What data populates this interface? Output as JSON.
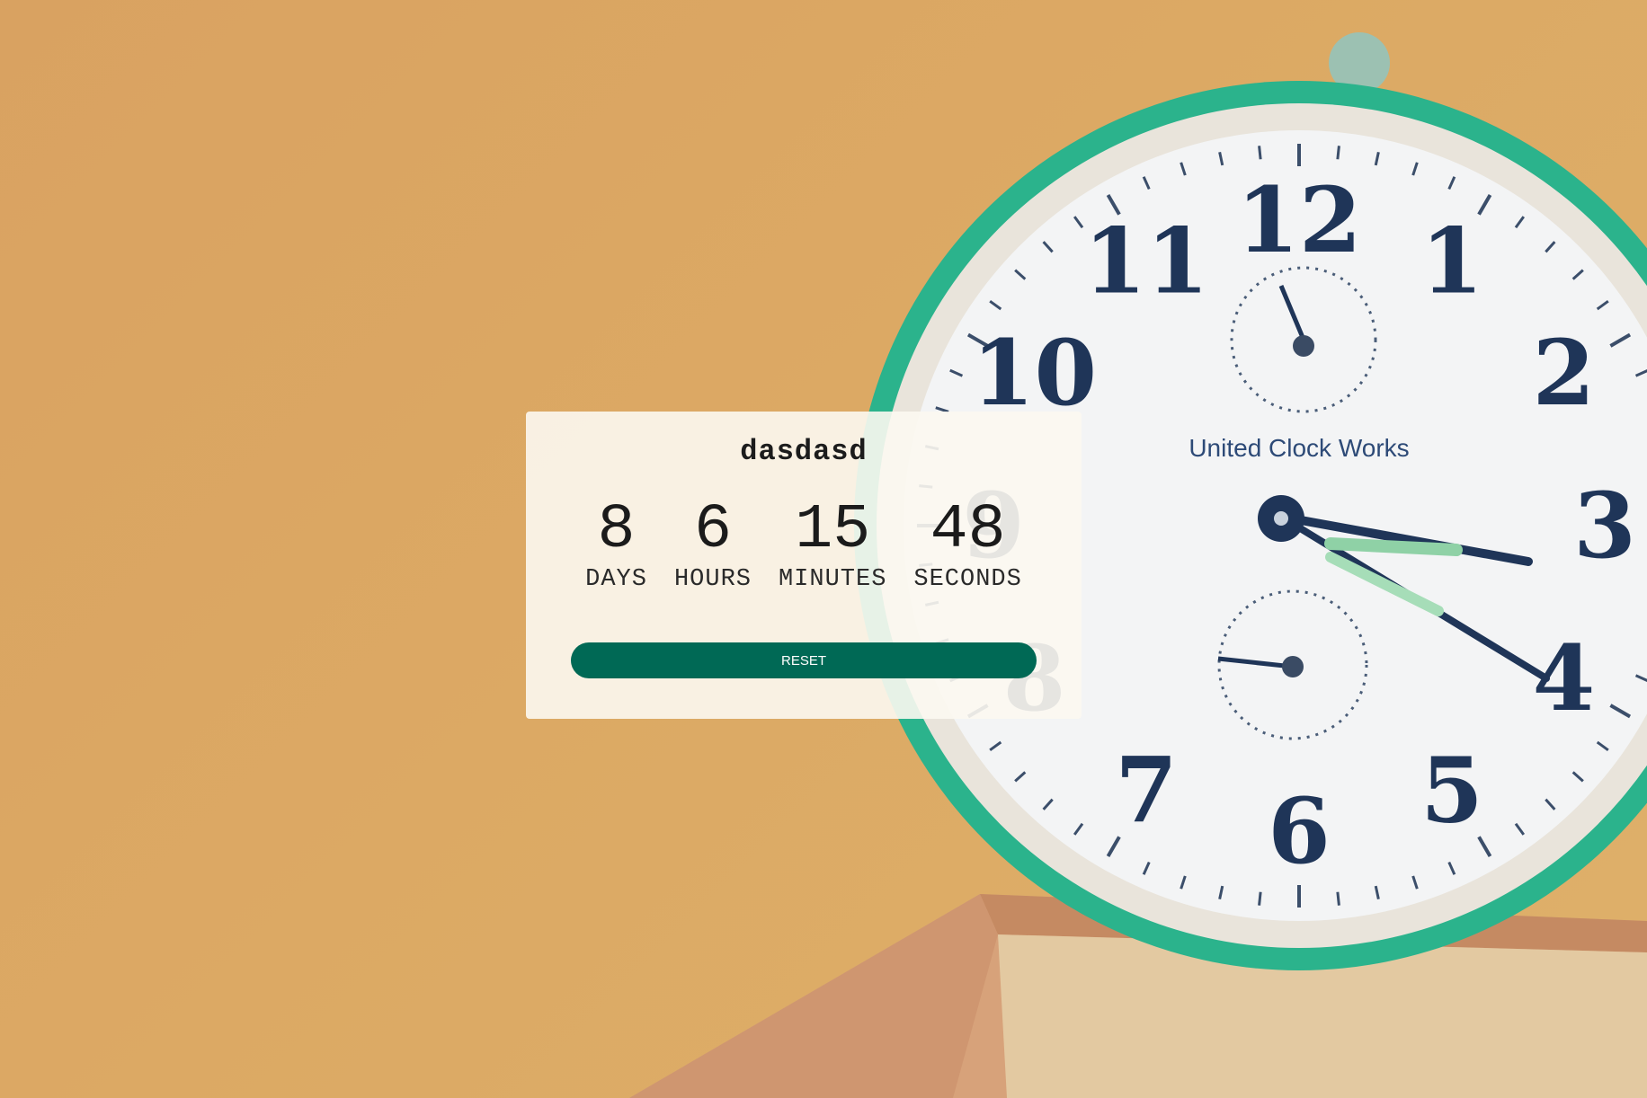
{
  "event": {
    "title": "dasdasd"
  },
  "countdown": {
    "units": [
      {
        "value": "8",
        "label": "DAYS"
      },
      {
        "value": "6",
        "label": "HOURS"
      },
      {
        "value": "15",
        "label": "MINUTES"
      },
      {
        "value": "48",
        "label": "SECONDS"
      }
    ]
  },
  "actions": {
    "reset_label": "RESET"
  },
  "background": {
    "clock_brand": "United Clock Works",
    "clock_numerals": [
      "12",
      "1",
      "2",
      "3",
      "4",
      "5",
      "6",
      "7",
      "8",
      "9",
      "10",
      "11"
    ]
  },
  "colors": {
    "background": "#dca964",
    "card": "#fcf8f1",
    "button": "#006955",
    "clock_rim": "#27b08a"
  }
}
